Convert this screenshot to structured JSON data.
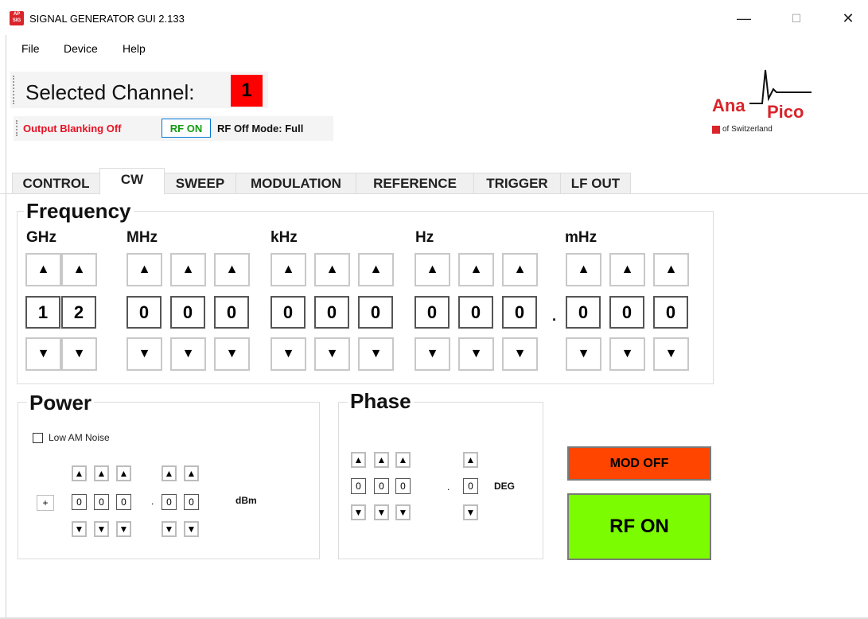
{
  "window": {
    "title": "SIGNAL GENERATOR GUI 2.133",
    "icon_text": "AP SIG",
    "minimize": "—",
    "maximize": "☐",
    "close": "✕"
  },
  "menu": [
    "File",
    "Device",
    "Help"
  ],
  "channel": {
    "label": "Selected Channel:",
    "number": "1"
  },
  "status": {
    "output_blanking": "Output Blanking Off",
    "rf_badge": "RF ON",
    "rf_off_mode": "RF Off Mode: Full"
  },
  "logo": {
    "ana": "Ana",
    "pico": "Pico",
    "swiss": "of Switzerland"
  },
  "tabs": [
    "CONTROL",
    "CW",
    "SWEEP",
    "MODULATION",
    "REFERENCE",
    "TRIGGER",
    "LF OUT"
  ],
  "active_tab": "CW",
  "frequency": {
    "title": "Frequency",
    "units": [
      "GHz",
      "MHz",
      "kHz",
      "Hz",
      "mHz"
    ],
    "digits": [
      "1",
      "2",
      "0",
      "0",
      "0",
      "0",
      "0",
      "0",
      "0",
      "0",
      "0",
      ".",
      "0",
      "0",
      "0"
    ],
    "up_symbol": "▲",
    "down_symbol": "▼"
  },
  "power": {
    "title": "Power",
    "low_am_noise": "Low AM Noise",
    "sign": "+",
    "digits": [
      "0",
      "0",
      "0",
      ".",
      "0",
      "0"
    ],
    "unit": "dBm"
  },
  "phase": {
    "title": "Phase",
    "digits": [
      "0",
      "0",
      "0",
      ".",
      "0"
    ],
    "unit": "DEG"
  },
  "buttons": {
    "mod_off": "MOD OFF",
    "rf_on": "RF ON"
  },
  "colors": {
    "red": "#ff0000",
    "mod_off_bg": "#ff4500",
    "rf_on_bg": "#7cfc00",
    "blanking_text": "#e81123"
  }
}
